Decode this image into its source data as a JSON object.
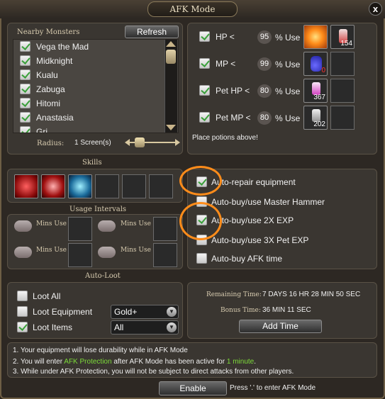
{
  "window": {
    "title": "AFK Mode",
    "close": "x"
  },
  "monsters": {
    "caption": "Nearby Monsters",
    "refresh": "Refresh",
    "list": [
      "Vega the Mad",
      "Midknight",
      "Kualu",
      "Zabuga",
      "Hitomi",
      "Anastasia",
      "Gri..."
    ],
    "radius_label": "Radius:",
    "radius_value": "1 Screen(s)"
  },
  "potions": {
    "rows": [
      {
        "label": "HP <",
        "value": "95",
        "unit": "% Use",
        "count": "154"
      },
      {
        "label": "MP <",
        "value": "99",
        "unit": "% Use",
        "count": "0"
      },
      {
        "label": "Pet HP <",
        "value": "80",
        "unit": "% Use",
        "count": "367"
      },
      {
        "label": "Pet MP <",
        "value": "80",
        "unit": "% Use",
        "count": "202"
      }
    ],
    "hint": "Place potions above!"
  },
  "skills": {
    "caption": "Skills",
    "intervals_caption": "Usage Intervals",
    "mins": [
      "Mins Use",
      "Mins Use",
      "Mins Use",
      "Mins Use"
    ]
  },
  "options": {
    "items": [
      {
        "label": "Auto-repair equipment",
        "checked": true
      },
      {
        "label": "Auto-buy/use Master Hammer",
        "checked": false
      },
      {
        "label": "Auto-buy/use 2X EXP",
        "checked": true
      },
      {
        "label": "Auto-buy/use 3X Pet EXP",
        "checked": false
      },
      {
        "label": "Auto-buy AFK time",
        "checked": false
      }
    ]
  },
  "loot": {
    "caption": "Auto-Loot",
    "all": "Loot All",
    "equipment": "Loot Equipment",
    "equipment_select": "Gold+",
    "items": "Loot Items",
    "items_select": "All"
  },
  "time": {
    "remaining_label": "Remaining Time:",
    "remaining_value": "7 DAYS 16 HR 28 MIN 50 SEC",
    "bonus_label": "Bonus Time:",
    "bonus_value": "36 MIN 11 SEC",
    "add": "Add Time"
  },
  "notes": {
    "line1": "1. Your equipment will lose durability while in AFK Mode",
    "line2_a": "2. You will enter ",
    "line2_b": "AFK Protection",
    "line2_c": " after AFK Mode has been active for ",
    "line2_d": "1 minute",
    "line2_e": ".",
    "line3": "3. While under AFK Protection, you will not be subject to direct attacks from other players."
  },
  "footer": {
    "enable": "Enable",
    "hint": "Press '.' to enter AFK Mode"
  },
  "colors": {
    "accent": "#ff8c1a",
    "check": "#3aa03a",
    "note_green": "#7ddc3a"
  }
}
